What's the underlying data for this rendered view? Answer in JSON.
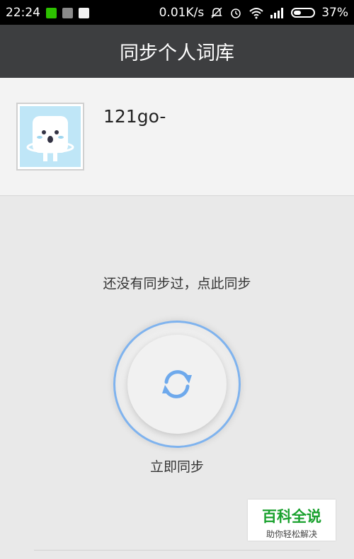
{
  "status_bar": {
    "time": "22:24",
    "network_speed": "0.01K/s",
    "battery_percent": "37%",
    "battery_level": 0.37,
    "app_icons": [
      "wechat-icon",
      "gallery-icon",
      "qq-icon"
    ],
    "right_icons": [
      "mute-icon",
      "alarm-icon",
      "wifi-icon",
      "signal-icon",
      "battery-icon"
    ]
  },
  "header": {
    "title": "同步个人词库"
  },
  "profile": {
    "username": "121go-"
  },
  "main": {
    "prompt": "还没有同步过，点此同步",
    "sync_label": "立即同步",
    "accent_color": "#7fb3ee"
  },
  "watermark": {
    "title": "百科全说",
    "subtitle": "助你轻松解决"
  }
}
